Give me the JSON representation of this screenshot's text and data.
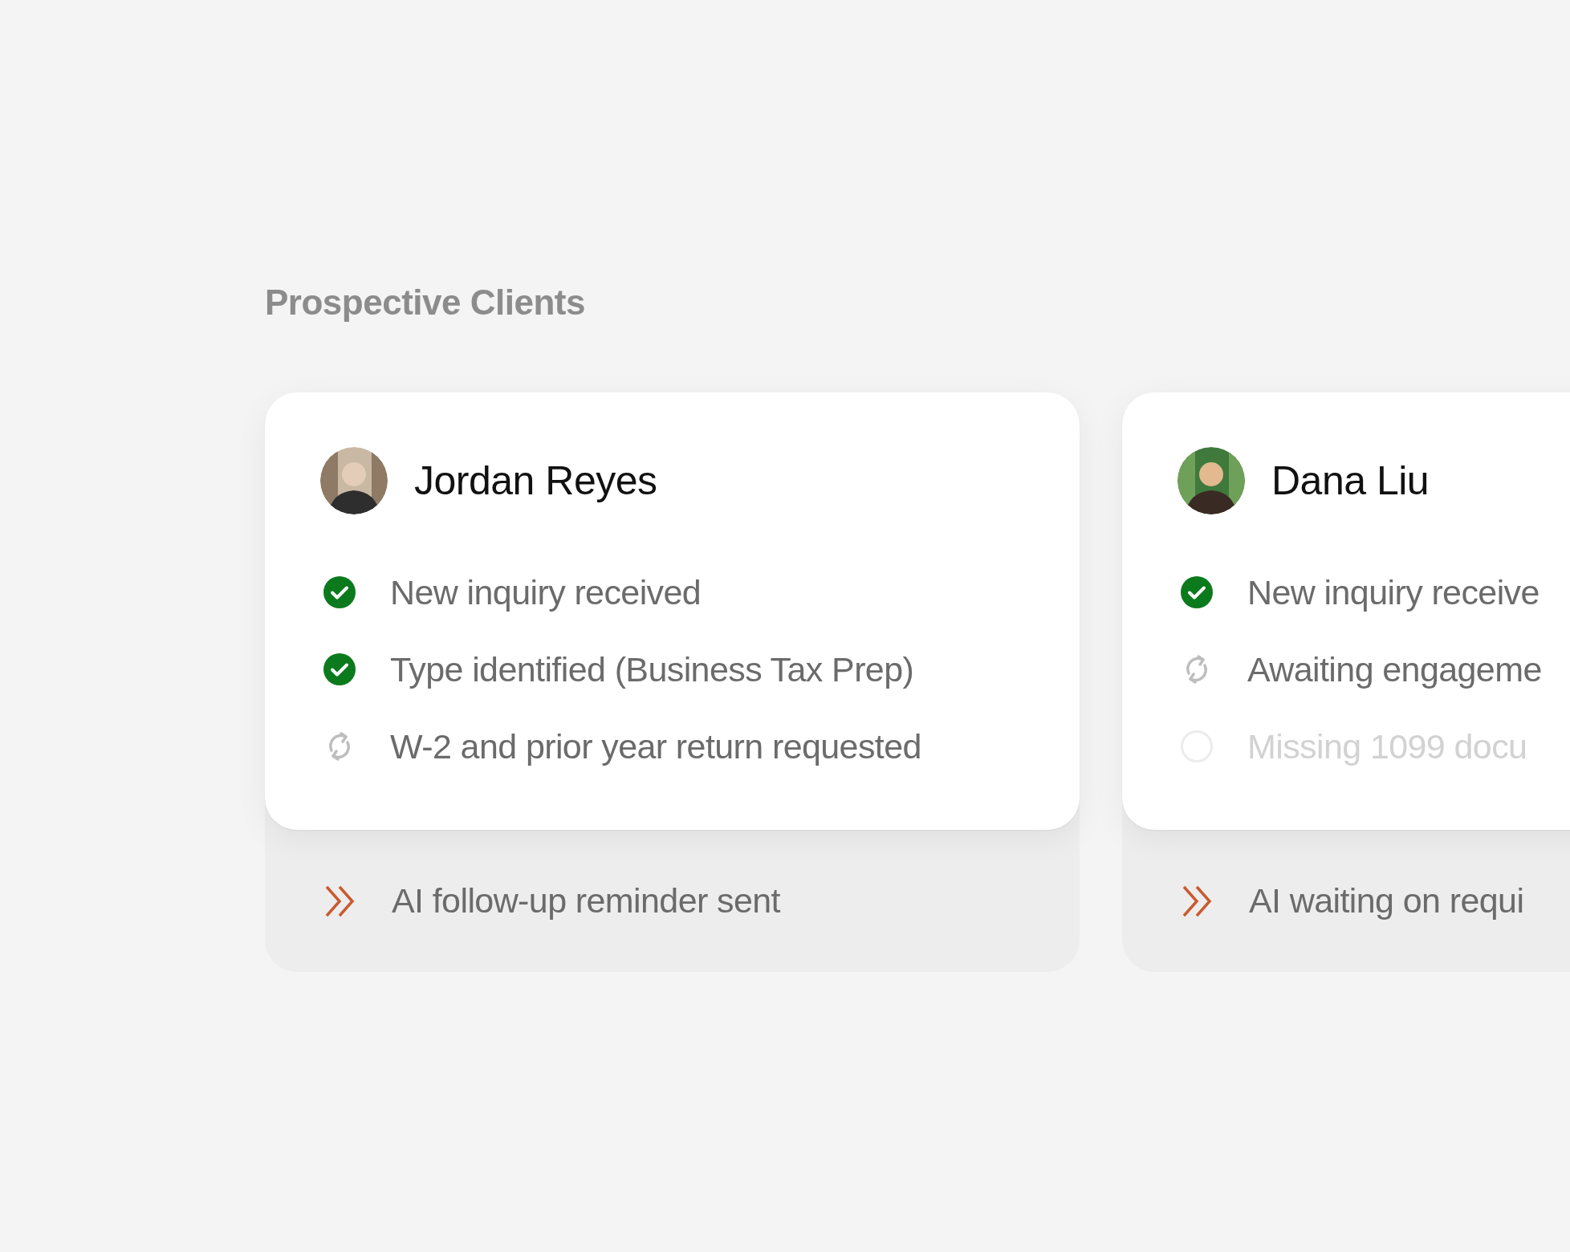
{
  "title": "Prospective Clients",
  "clients": [
    {
      "name": "Jordan Reyes",
      "steps": [
        {
          "kind": "done",
          "label": "New inquiry received"
        },
        {
          "kind": "done",
          "label": "Type identified (Business Tax Prep)"
        },
        {
          "kind": "pending",
          "label": "W-2 and prior year return requested"
        }
      ],
      "footer": "AI follow-up reminder sent"
    },
    {
      "name": "Dana Liu",
      "steps": [
        {
          "kind": "done",
          "label": "New inquiry receive"
        },
        {
          "kind": "pending",
          "label": "Awaiting engageme"
        },
        {
          "kind": "missing",
          "label": "Missing 1099 docu"
        }
      ],
      "footer": "AI waiting on requi"
    }
  ]
}
